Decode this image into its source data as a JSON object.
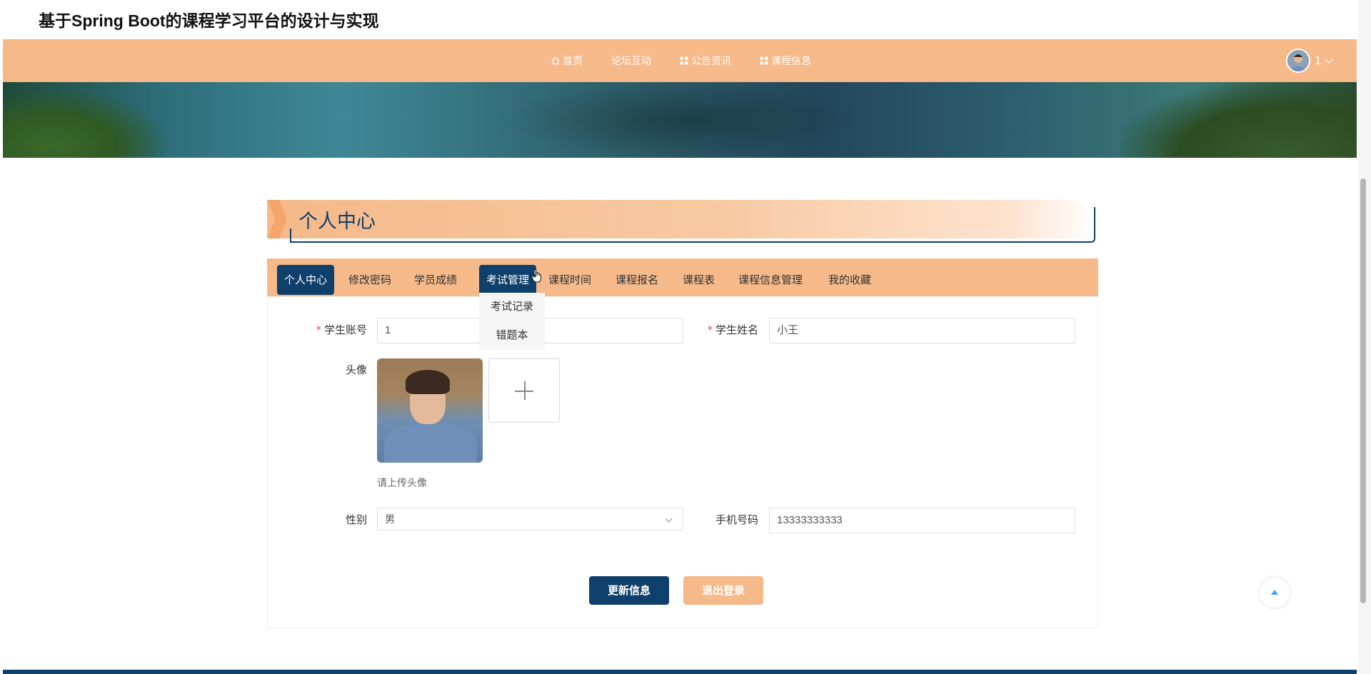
{
  "site": {
    "title": "基于Spring Boot的课程学习平台的设计与实现"
  },
  "nav": {
    "items": [
      {
        "label": "首页",
        "icon": "home-icon"
      },
      {
        "label": "论坛互动",
        "icon": ""
      },
      {
        "label": "公告资讯",
        "icon": "grid-icon"
      },
      {
        "label": "课程信息",
        "icon": "grid-icon"
      }
    ],
    "user": {
      "name": "1"
    }
  },
  "section": {
    "title": "个人中心"
  },
  "tabs": [
    {
      "label": "个人中心",
      "active": true
    },
    {
      "label": "修改密码"
    },
    {
      "label": "学员成绩"
    },
    {
      "label": "考试管理",
      "active": true
    },
    {
      "label": "课程时间"
    },
    {
      "label": "课程报名"
    },
    {
      "label": "课程表"
    },
    {
      "label": "课程信息管理"
    },
    {
      "label": "我的收藏"
    }
  ],
  "dropdown": {
    "items": [
      "考试记录",
      "错题本"
    ]
  },
  "form": {
    "account_label": "学生账号",
    "account_value": "1",
    "name_label": "学生姓名",
    "name_value": "小王",
    "avatar_label": "头像",
    "avatar_hint": "请上传头像",
    "gender_label": "性别",
    "gender_value": "男",
    "phone_label": "手机号码",
    "phone_value": "13333333333",
    "required_mark": "*"
  },
  "buttons": {
    "update": "更新信息",
    "logout": "退出登录"
  },
  "colors": {
    "accent": "#f5b98a",
    "primary": "#0f3f6b"
  }
}
